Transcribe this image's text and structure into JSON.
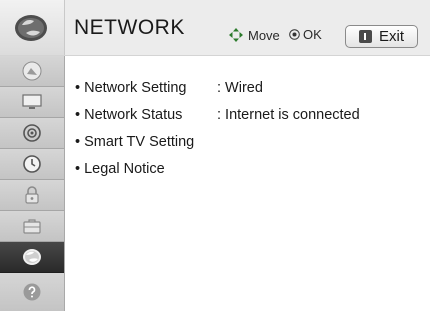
{
  "header": {
    "title": "NETWORK",
    "icon": "network-globe-icon",
    "hints": {
      "move_label": "Move",
      "ok_label": "OK"
    },
    "exit_label": "Exit"
  },
  "sidebar": {
    "items": [
      {
        "name": "picture",
        "icon": "picture-icon",
        "active": false
      },
      {
        "name": "screen",
        "icon": "monitor-icon",
        "active": false
      },
      {
        "name": "audio",
        "icon": "speaker-icon",
        "active": false
      },
      {
        "name": "time",
        "icon": "clock-icon",
        "active": false
      },
      {
        "name": "lock",
        "icon": "lock-icon",
        "active": false
      },
      {
        "name": "option",
        "icon": "briefcase-icon",
        "active": false
      },
      {
        "name": "network",
        "icon": "network-globe-icon",
        "active": true
      },
      {
        "name": "support",
        "icon": "question-icon",
        "active": false
      }
    ]
  },
  "menu": {
    "items": [
      {
        "label": "• Network Setting",
        "value": ": Wired"
      },
      {
        "label": "• Network Status",
        "value": ": Internet is connected"
      },
      {
        "label": "• Smart TV Setting",
        "value": ""
      },
      {
        "label": "• Legal Notice",
        "value": ""
      }
    ]
  },
  "colors": {
    "header_bg": "#ececec",
    "sidebar_bg": "#c4c4c4",
    "sidebar_active_bg": "#2a2a2a",
    "content_bg": "#ffffff",
    "text": "#1a1a1a"
  }
}
